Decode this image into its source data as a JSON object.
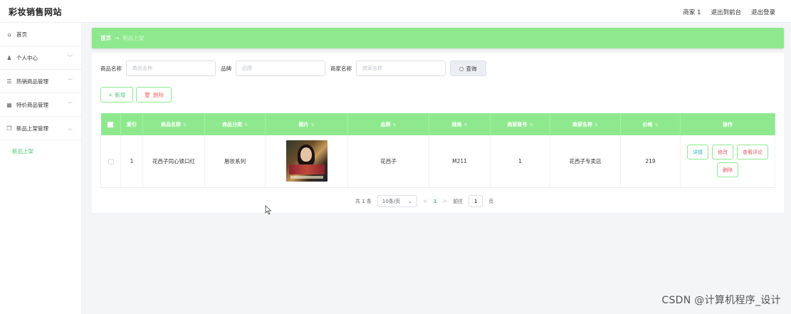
{
  "app": {
    "brand": "彩妆销售网站"
  },
  "topnav": {
    "user": "商家 1",
    "front": "退出到前台",
    "logout": "退出登录"
  },
  "sidebar": {
    "items": [
      {
        "label": "首页",
        "icon": "home-icon",
        "glyph": "⌂"
      },
      {
        "label": "个人中心",
        "icon": "person-icon",
        "glyph": "♟",
        "chevron": "﹀"
      },
      {
        "label": "热销商品管理",
        "icon": "sliders-icon",
        "glyph": "☰",
        "chevron": "﹀"
      },
      {
        "label": "特价商品管理",
        "icon": "grid-icon",
        "glyph": "▦",
        "chevron": "﹀"
      },
      {
        "label": "新品上架管理",
        "icon": "copy-icon",
        "glyph": "❐",
        "chevron": "︿"
      }
    ],
    "submenu": [
      {
        "label": "新品上架"
      }
    ]
  },
  "breadcrumb": {
    "home": "首页",
    "arrow": "→",
    "current": "新品上架"
  },
  "search": {
    "name_label": "商品名称",
    "name_placeholder": "商品名称",
    "brand_label": "品牌",
    "brand_placeholder": "品牌",
    "shop_label": "商家名称",
    "shop_placeholder": "商家名称",
    "query_label": "查询"
  },
  "actions": {
    "add_label": "新增",
    "delete_label": "删除"
  },
  "table": {
    "headers": [
      "索引",
      "商品名称",
      "商品分类",
      "图片",
      "品牌",
      "规格",
      "商家账号",
      "商家名称",
      "价格",
      "操作"
    ],
    "rows": [
      {
        "index": "1",
        "name": "花西子同心锁口红",
        "category": "唇妆系列",
        "brand": "花西子",
        "spec": "M211",
        "account": "1",
        "shop": "花西子专卖店",
        "price": "219"
      }
    ],
    "ops": {
      "detail": "详情",
      "edit": "修改",
      "review": "查看评论",
      "remove": "删除"
    }
  },
  "pager": {
    "total": "共 1 条",
    "size": "10条/页",
    "prev": "<",
    "current": "1",
    "next": ">",
    "goto": "前往",
    "page_value": "1",
    "page_unit": "页"
  },
  "watermark": "CSDN @计算机程序_设计",
  "colors": {
    "accent": "#8ee98e",
    "active": "#4ecb73",
    "danger": "#e6586a"
  }
}
